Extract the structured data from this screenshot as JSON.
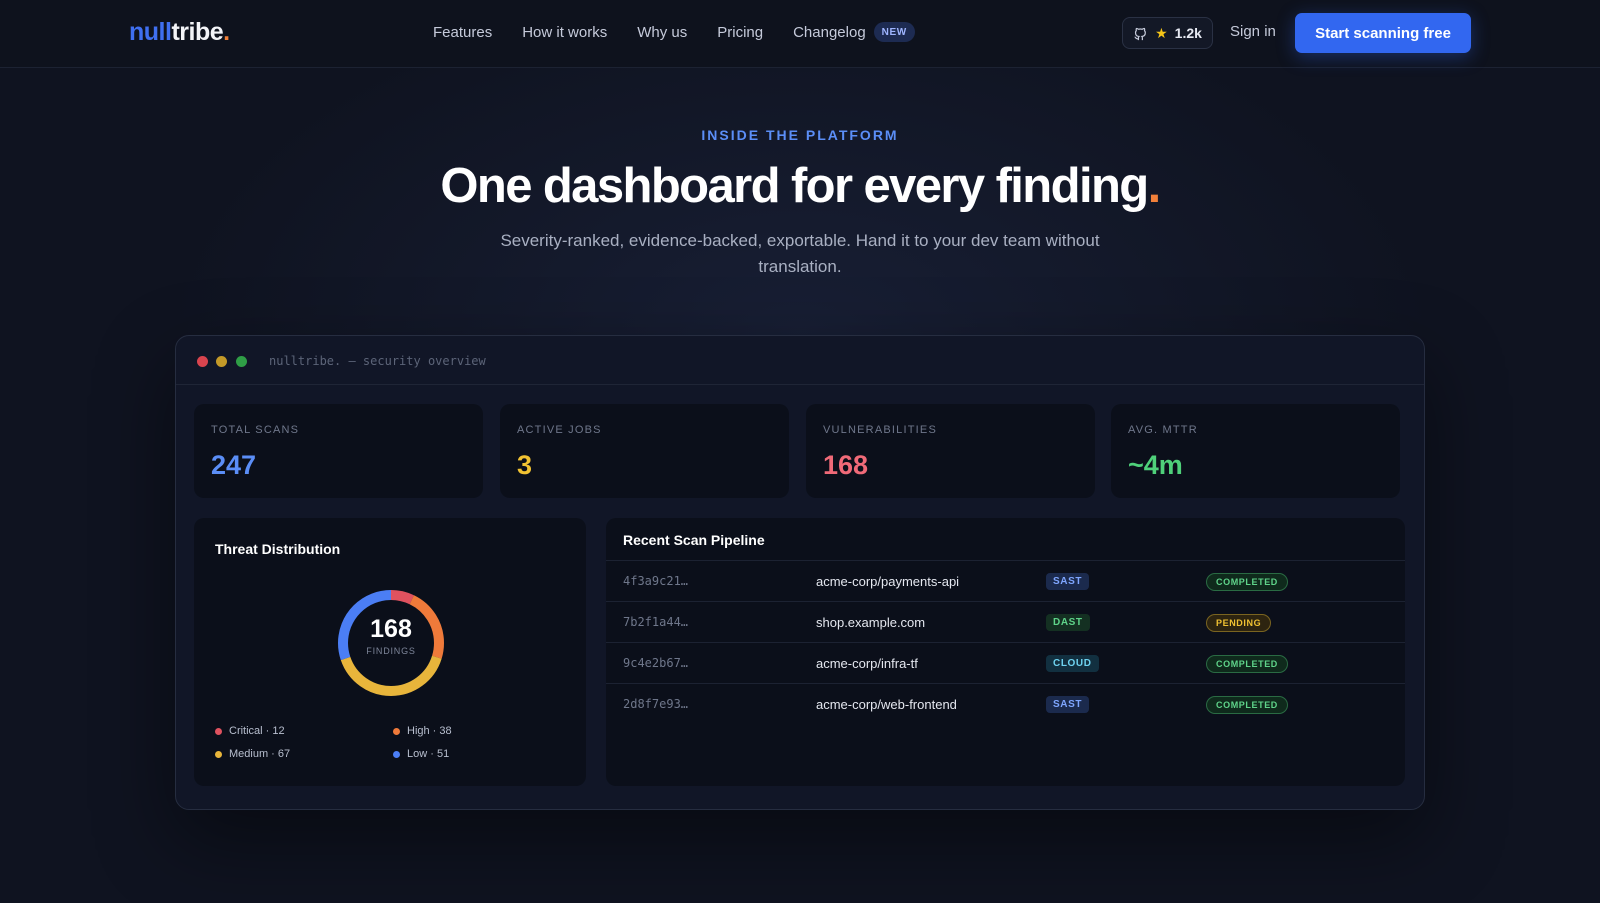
{
  "colors": {
    "accent": "#3267f0",
    "brand_blue": "#3f6ff0",
    "brand_orange": "#f2803a",
    "critical": "#e0525f",
    "high": "#ef7a3a",
    "medium": "#e8b53b",
    "low": "#4b7ef5"
  },
  "nav": {
    "logo": {
      "part1": "null",
      "part2": "tribe",
      "dot": "."
    },
    "links": [
      "Features",
      "How it works",
      "Why us",
      "Pricing",
      "Changelog"
    ],
    "new_badge": "NEW",
    "github": {
      "icon": "github-icon",
      "star_icon": "star-icon",
      "stars": "1.2k"
    },
    "signin": "Sign in",
    "cta": "Start scanning free"
  },
  "hero": {
    "eyebrow": "INSIDE THE PLATFORM",
    "headline": "One dashboard for every finding",
    "headline_dot": ".",
    "subtitle": "Severity-ranked, evidence-backed, exportable. Hand it to your dev team without translation."
  },
  "dashboard": {
    "window_title": "nulltribe. — security overview",
    "stats": [
      {
        "label": "TOTAL SCANS",
        "value": "247",
        "color": "#5b8ef7"
      },
      {
        "label": "ACTIVE JOBS",
        "value": "3",
        "color": "#f1c232"
      },
      {
        "label": "VULNERABILITIES",
        "value": "168",
        "color": "#f06a78"
      },
      {
        "label": "AVG. MTTR",
        "value": "~4m",
        "color": "#4fd07a"
      }
    ],
    "threat": {
      "title": "Threat Distribution",
      "total": "168",
      "total_label": "FINDINGS",
      "legend": [
        {
          "label": "Critical · 12",
          "color": "#e0525f"
        },
        {
          "label": "High · 38",
          "color": "#ef7a3a"
        },
        {
          "label": "Medium · 67",
          "color": "#e8b53b"
        },
        {
          "label": "Low · 51",
          "color": "#4b7ef5"
        }
      ]
    },
    "pipeline": {
      "title": "Recent Scan Pipeline",
      "rows": [
        {
          "id": "4f3a9c21…",
          "target": "acme-corp/payments-api",
          "type": "SAST",
          "status": "COMPLETED"
        },
        {
          "id": "7b2f1a44…",
          "target": "shop.example.com",
          "type": "DAST",
          "status": "PENDING"
        },
        {
          "id": "9c4e2b67…",
          "target": "acme-corp/infra-tf",
          "type": "CLOUD",
          "status": "COMPLETED"
        },
        {
          "id": "2d8f7e93…",
          "target": "acme-corp/web-frontend",
          "type": "SAST",
          "status": "COMPLETED"
        }
      ]
    }
  }
}
